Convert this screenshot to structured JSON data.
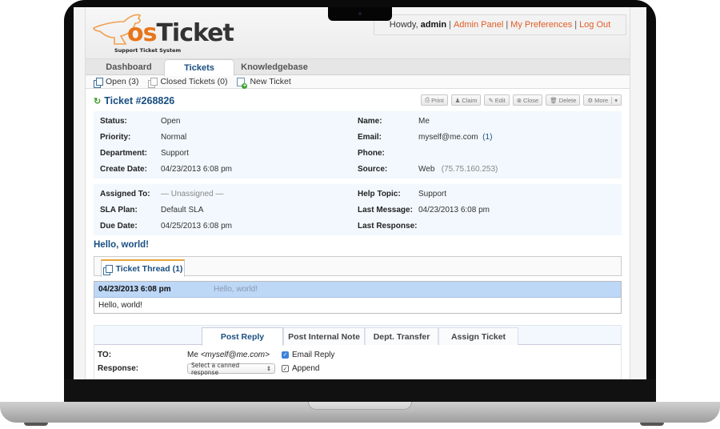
{
  "app": {
    "logo_primary": "os",
    "logo_secondary": "Ticket",
    "logo_subtitle": "Support Ticket System"
  },
  "userbar": {
    "greeting": "Howdy,",
    "username": "admin",
    "links": [
      "Admin Panel",
      "My Preferences",
      "Log Out"
    ],
    "separator": "|",
    "link_color": "#e05d25"
  },
  "nav": {
    "tabs": [
      {
        "label": "Dashboard",
        "active": false
      },
      {
        "label": "Tickets",
        "active": true
      },
      {
        "label": "Knowledgebase",
        "active": false
      }
    ],
    "subnav": [
      {
        "label": "Open (3)",
        "icon": "documents-icon"
      },
      {
        "label": "Closed Tickets (0)",
        "icon": "documents-icon"
      },
      {
        "label": "New Ticket",
        "icon": "new-document-icon"
      }
    ]
  },
  "ticket": {
    "title": "Ticket #268826",
    "actions": [
      {
        "label": "Print",
        "icon": "printer-icon"
      },
      {
        "label": "Claim",
        "icon": "user-icon"
      },
      {
        "label": "Edit",
        "icon": "edit-icon"
      },
      {
        "label": "Close",
        "icon": "close-circle-icon"
      },
      {
        "label": "Delete",
        "icon": "trash-icon"
      },
      {
        "label": "More",
        "icon": "gear-icon"
      }
    ],
    "info_left": [
      {
        "label": "Status:",
        "value": "Open"
      },
      {
        "label": "Priority:",
        "value": "Normal"
      },
      {
        "label": "Department:",
        "value": "Support"
      },
      {
        "label": "Create Date:",
        "value": "04/23/2013 6:08 pm"
      }
    ],
    "info_right": [
      {
        "label": "Name:",
        "value": "Me"
      },
      {
        "label": "Email:",
        "value": "myself@me.com",
        "extra": "(1)"
      },
      {
        "label": "Phone:",
        "value": ""
      },
      {
        "label": "Source:",
        "value": "Web",
        "extra": "(75.75.160.253)"
      }
    ],
    "assign_left": [
      {
        "label": "Assigned To:",
        "value": "— Unassigned —"
      },
      {
        "label": "SLA Plan:",
        "value": "Default SLA"
      },
      {
        "label": "Due Date:",
        "value": "04/25/2013 6:08 pm"
      }
    ],
    "assign_right": [
      {
        "label": "Help Topic:",
        "value": "Support"
      },
      {
        "label": "Last Message:",
        "value": "04/23/2013 6:08 pm"
      },
      {
        "label": "Last Response:",
        "value": ""
      }
    ],
    "subject": "Hello, world!"
  },
  "thread": {
    "tab_label": "Ticket Thread (1)",
    "entries": [
      {
        "date": "04/23/2013 6:08 pm",
        "title": "Hello, world!",
        "body": "Hello, world!"
      }
    ]
  },
  "reply": {
    "tabs": [
      {
        "label": "Post Reply",
        "active": true
      },
      {
        "label": "Post Internal Note",
        "active": false
      },
      {
        "label": "Dept. Transfer",
        "active": false
      },
      {
        "label": "Assign Ticket",
        "active": false
      }
    ],
    "to_label": "TO:",
    "to_name": "Me",
    "to_email": "<myself@me.com>",
    "email_reply_label": "Email Reply",
    "email_reply_checked": true,
    "response_label": "Response:",
    "canned_select": "Select a canned response",
    "append_label": "Append",
    "append_checked": true
  }
}
